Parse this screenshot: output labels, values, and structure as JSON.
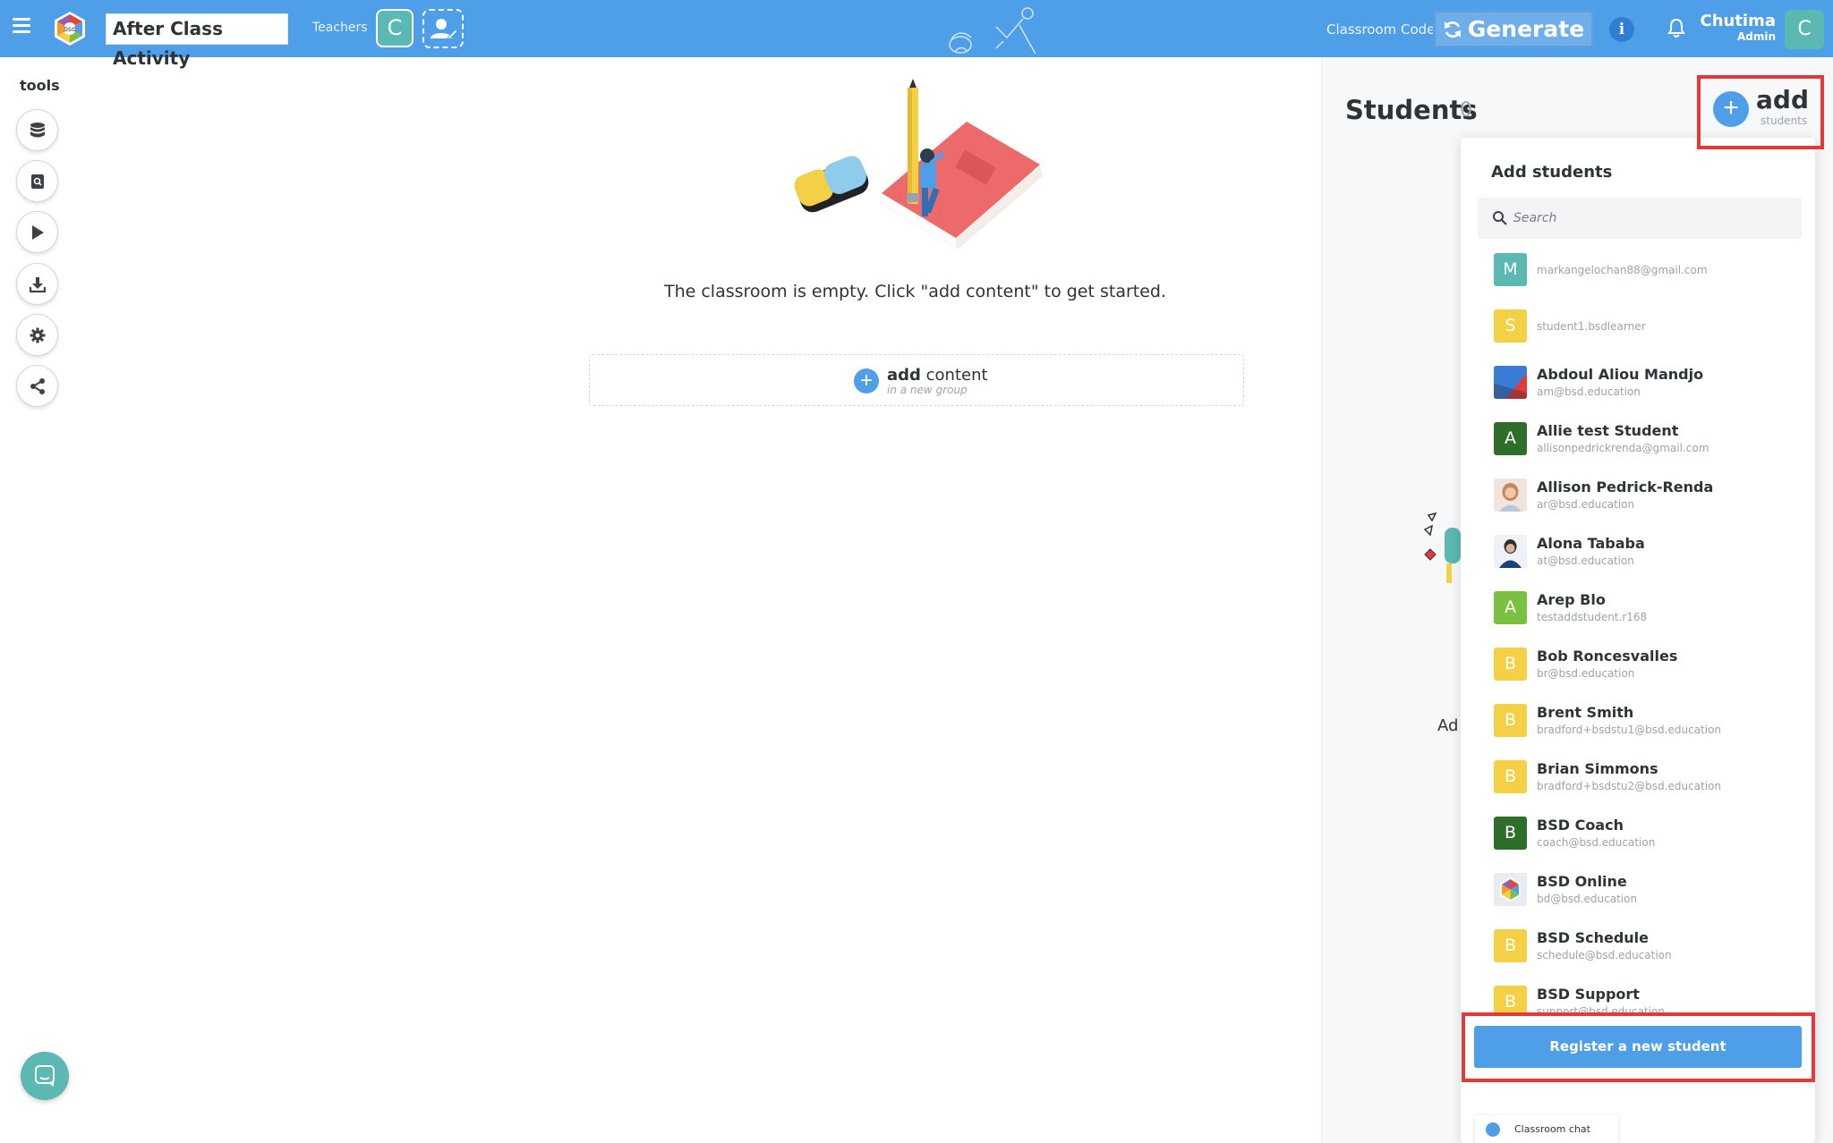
{
  "header": {
    "activity_title": "After Class Activity",
    "teachers_label": "Teachers",
    "teacher_avatar_initial": "C",
    "classroom_code_label": "Classroom Code",
    "generate_label": "Generate",
    "info_label": "i",
    "user_name": "Chutima",
    "user_role": "Admin",
    "user_avatar_initial": "C"
  },
  "tools": {
    "label": "tools",
    "items": [
      {
        "icon": "database-icon"
      },
      {
        "icon": "book-icon"
      },
      {
        "icon": "play-icon"
      },
      {
        "icon": "download-icon"
      },
      {
        "icon": "gear-icon"
      },
      {
        "icon": "share-icon"
      }
    ]
  },
  "main": {
    "empty_message": "The classroom is empty. Click \"add content\" to get started.",
    "add_content_bold": "add",
    "add_content_rest": " content",
    "add_content_sub": "in a new group"
  },
  "students_panel": {
    "heading": "Students",
    "count": "0",
    "add_label": "add",
    "add_sub_label": "students",
    "background_text_partial": "Ad"
  },
  "add_students": {
    "title": "Add students",
    "search_placeholder": "Search",
    "students": [
      {
        "initial": "M",
        "color": "#5cb8b2",
        "name": "",
        "email": "markangelochan88@gmail.com"
      },
      {
        "initial": "S",
        "color": "#f3d046",
        "name": "",
        "email": "student1.bsdlearner"
      },
      {
        "initial": "",
        "color": "#3a7bd5",
        "photo": "flag",
        "name": "Abdoul Aliou Mandjo",
        "email": "am@bsd.education"
      },
      {
        "initial": "A",
        "color": "#2f6d2a",
        "name": "Allie test Student",
        "email": "allisonpedrickrenda@gmail.com"
      },
      {
        "initial": "",
        "color": "#f1e4dc",
        "photo": "person-woman",
        "name": "Allison Pedrick-Renda",
        "email": "ar@bsd.education"
      },
      {
        "initial": "",
        "color": "#eef1f6",
        "photo": "person-dark",
        "name": "Alona Tababa",
        "email": "at@bsd.education"
      },
      {
        "initial": "A",
        "color": "#7ac142",
        "name": "Arep Blo",
        "email": "testaddstudent.r168"
      },
      {
        "initial": "B",
        "color": "#f3d046",
        "name": "Bob Roncesvalles",
        "email": "br@bsd.education"
      },
      {
        "initial": "B",
        "color": "#f3d046",
        "name": "Brent Smith",
        "email": "bradford+bsdstu1@bsd.education"
      },
      {
        "initial": "B",
        "color": "#f3d046",
        "name": "Brian Simmons",
        "email": "bradford+bsdstu2@bsd.education"
      },
      {
        "initial": "B",
        "color": "#2f6d2a",
        "name": "BSD Coach",
        "email": "coach@bsd.education"
      },
      {
        "initial": "",
        "color": "#e8ecf0",
        "photo": "bsd-logo",
        "name": "BSD Online",
        "email": "bd@bsd.education"
      },
      {
        "initial": "B",
        "color": "#f3d046",
        "name": "BSD Schedule",
        "email": "schedule@bsd.education"
      },
      {
        "initial": "B",
        "color": "#f3d046",
        "name": "BSD Support",
        "email": "support@bsd.education"
      }
    ],
    "register_label": "Register a new student"
  },
  "chat": {
    "label": "Classroom chat"
  },
  "colors": {
    "topbar": "#4f9fe8",
    "accent": "#4f9fe8",
    "highlight": "#e53935",
    "teal": "#5cb8b2"
  }
}
